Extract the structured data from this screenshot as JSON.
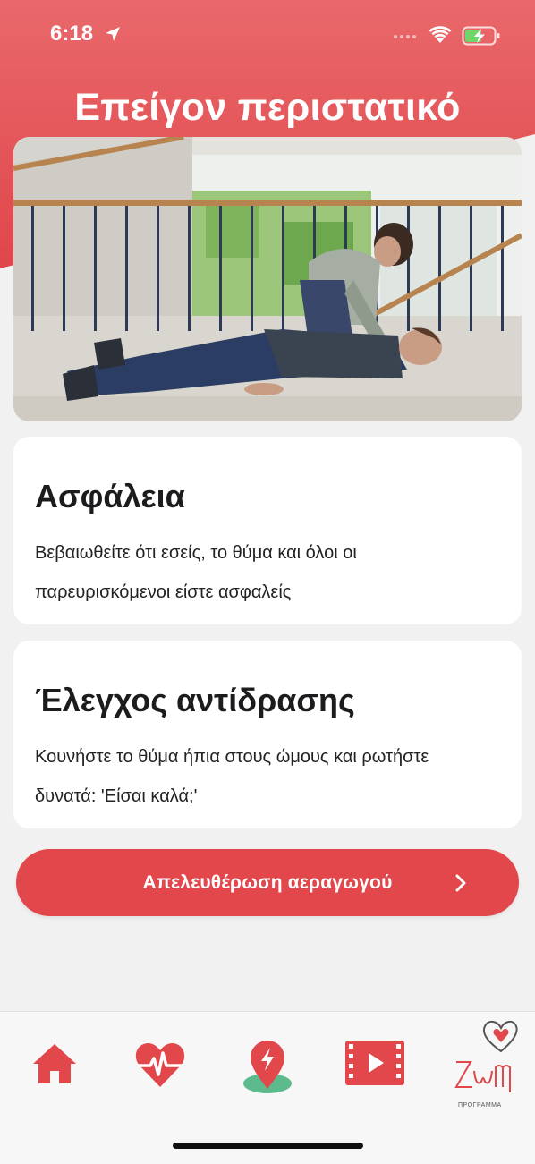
{
  "status_bar": {
    "time": "6:18"
  },
  "header": {
    "title": "Επείγον περιστατικό"
  },
  "cards": [
    {
      "title": "Ασφάλεια",
      "text": "Βεβαιωθείτε ότι εσείς, το θύμα και όλοι οι παρευρισκόμενοι είστε ασφαλείς"
    },
    {
      "title": "Έλεγχος αντίδρασης",
      "text": "Κουνήστε το θύμα ήπια στους ώμους και ρωτήστε δυνατά: 'Είσαι καλά;'"
    }
  ],
  "next_button": {
    "label": "Απελευθέρωση αεραγωγού"
  },
  "tab_bar": {
    "logo_subtitle": "ΠΡΟΓΡΑΜΜΑ",
    "items": [
      "home-icon",
      "heartbeat-icon",
      "map-pin-icon",
      "video-icon",
      "zoi-logo"
    ]
  },
  "colors": {
    "accent": "#e2474b",
    "background": "#f1f1f2"
  }
}
